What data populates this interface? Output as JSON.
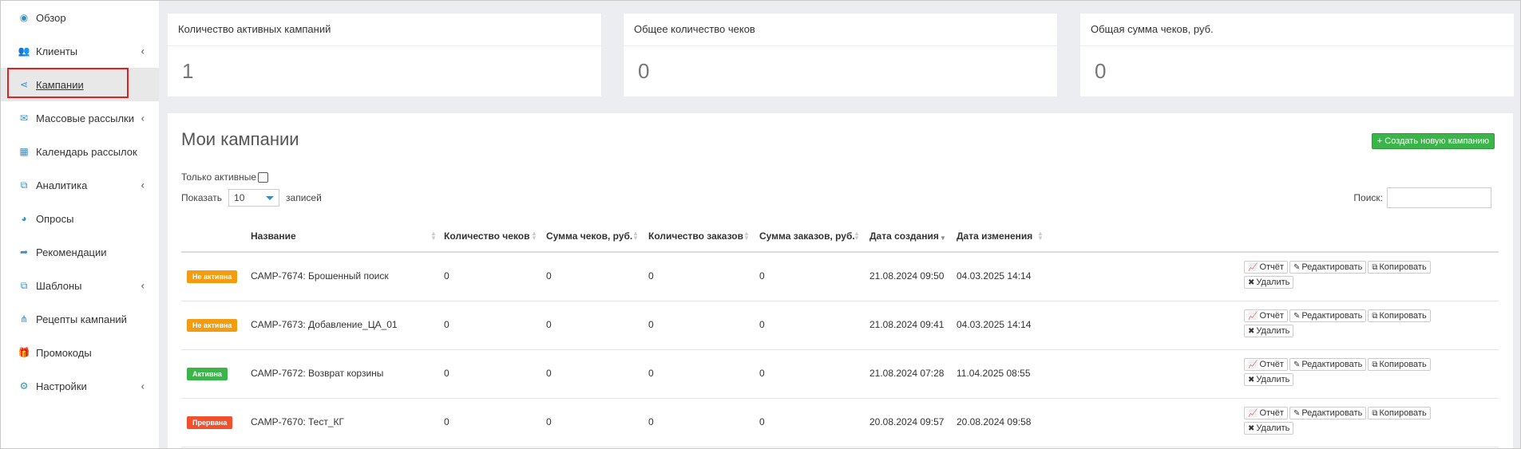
{
  "sidebar": {
    "items": [
      {
        "label": "Обзор",
        "icon": "dashboard-icon",
        "glyph": "◉",
        "chevron": false
      },
      {
        "label": "Клиенты",
        "icon": "users-icon",
        "glyph": "👥",
        "chevron": true
      },
      {
        "label": "Кампании",
        "icon": "share-icon",
        "glyph": "⋖",
        "chevron": false,
        "active": true
      },
      {
        "label": "Массовые рассылки",
        "icon": "envelope-icon",
        "glyph": "✉",
        "chevron": true
      },
      {
        "label": "Календарь рассылок",
        "icon": "calendar-icon",
        "glyph": "▦",
        "chevron": false
      },
      {
        "label": "Аналитика",
        "icon": "copy-icon",
        "glyph": "⧉",
        "chevron": true
      },
      {
        "label": "Опросы",
        "icon": "pie-chart-icon",
        "glyph": "◕",
        "chevron": false
      },
      {
        "label": "Рекомендации",
        "icon": "share-arrow-icon",
        "glyph": "➦",
        "chevron": false
      },
      {
        "label": "Шаблоны",
        "icon": "copy-icon",
        "glyph": "⧉",
        "chevron": true
      },
      {
        "label": "Рецепты кампаний",
        "icon": "sitemap-icon",
        "glyph": "⋔",
        "chevron": false
      },
      {
        "label": "Промокоды",
        "icon": "gift-icon",
        "glyph": "🎁",
        "chevron": false
      },
      {
        "label": "Настройки",
        "icon": "gear-icon",
        "glyph": "⚙",
        "chevron": true
      }
    ],
    "chevron_glyph": "‹"
  },
  "stats": [
    {
      "title": "Количество активных кампаний",
      "value": "1"
    },
    {
      "title": "Общее количество чеков",
      "value": "0"
    },
    {
      "title": "Общая сумма чеков, руб.",
      "value": "0"
    }
  ],
  "campaigns": {
    "title": "Мои кампании",
    "create_button": "+ Создать новую кампанию",
    "only_active_label": "Только активные",
    "show_label": "Показать",
    "page_size": "10",
    "records_label": "записей",
    "search_label": "Поиск:",
    "columns": [
      "Название",
      "Количество чеков",
      "Сумма чеков, руб.",
      "Количество заказов",
      "Сумма заказов, руб.",
      "Дата создания",
      "Дата изменения"
    ],
    "actions": {
      "report": "Отчёт",
      "edit": "Редактировать",
      "copy": "Копировать",
      "delete": "Удалить"
    },
    "rows": [
      {
        "status": "Не активна",
        "status_color": "#f39c12",
        "name": "CAMP-7674: Брошенный поиск",
        "checks": "0",
        "checks_sum": "0",
        "orders": "0",
        "orders_sum": "0",
        "created": "21.08.2024 09:50",
        "modified": "04.03.2025 14:14"
      },
      {
        "status": "Не активна",
        "status_color": "#f39c12",
        "name": "CAMP-7673: Добавление_ЦА_01",
        "checks": "0",
        "checks_sum": "0",
        "orders": "0",
        "orders_sum": "0",
        "created": "21.08.2024 09:41",
        "modified": "04.03.2025 14:14"
      },
      {
        "status": "Активна",
        "status_color": "#3bb54a",
        "name": "CAMP-7672: Возврат корзины",
        "checks": "0",
        "checks_sum": "0",
        "orders": "0",
        "orders_sum": "0",
        "created": "21.08.2024 07:28",
        "modified": "11.04.2025 08:55"
      },
      {
        "status": "Прервана",
        "status_color": "#f0502b",
        "name": "CAMP-7670: Тест_КГ",
        "checks": "0",
        "checks_sum": "0",
        "orders": "0",
        "orders_sum": "0",
        "created": "20.08.2024 09:57",
        "modified": "20.08.2024 09:58"
      }
    ]
  },
  "colors": {
    "accent": "#3c8dbc",
    "highlight_border": "#e0211f",
    "success": "#3bb54a",
    "warning": "#f39c12",
    "danger": "#f0502b"
  }
}
